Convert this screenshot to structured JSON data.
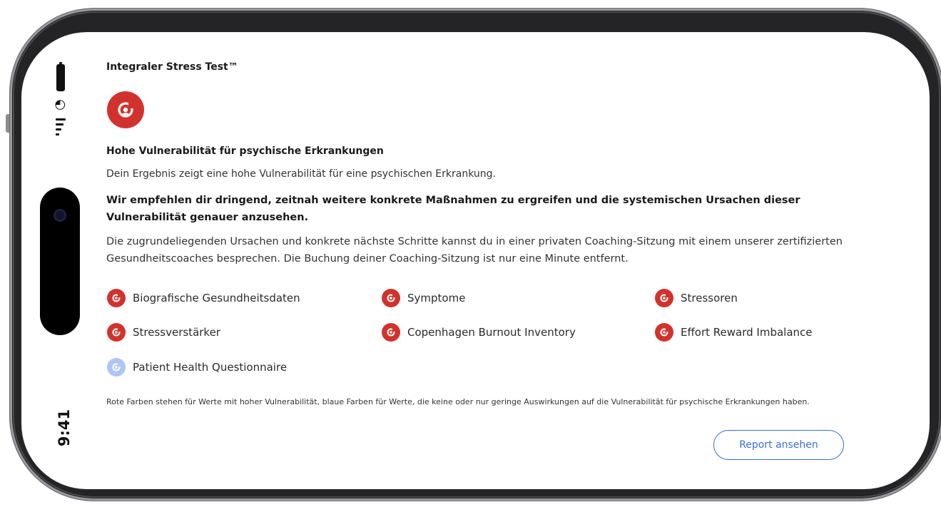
{
  "status_bar": {
    "time": "9:41"
  },
  "app": {
    "title": "Integraler Stress Test™"
  },
  "result": {
    "icon": "stress-gauge-icon",
    "heading": "Hohe Vulnerabilität für psychische Erkrankungen",
    "summary": "Dein Ergebnis zeigt eine hohe Vulnerabilität für eine psychischen Erkrankung.",
    "recommendation": "Wir empfehlen dir dringend, zeitnah weitere konkrete Maßnahmen zu ergreifen und die systemischen Ursachen dieser Vulnerabilität genauer anzusehen.",
    "details": "Die zugrundeliegenden Ursachen und konkrete nächste Schritte kannst du in einer privaten Coaching-Sitzung mit einem unserer zertifizierten Gesundheitscoaches besprechen. Die Buchung deiner Coaching-Sitzung ist nur eine Minute entfernt."
  },
  "factors": [
    {
      "label": "Biografische Gesundheitsdaten",
      "status": "red"
    },
    {
      "label": "Symptome",
      "status": "red"
    },
    {
      "label": "Stressoren",
      "status": "red"
    },
    {
      "label": "Stressverstärker",
      "status": "red"
    },
    {
      "label": "Copenhagen Burnout Inventory",
      "status": "red"
    },
    {
      "label": "Effort Reward Imbalance",
      "status": "red"
    },
    {
      "label": "Patient Health Questionnaire",
      "status": "blue"
    }
  ],
  "legend": "Rote Farben stehen für Werte mit hoher Vulnerabilität, blaue Farben für Werte, die keine oder nur geringe Auswirkungen auf die Vulnerabilität für psychische Erkrankungen haben.",
  "actions": {
    "report_button": "Report ansehen"
  },
  "colors": {
    "red": "#d2322d",
    "blue": "#aec5f5",
    "accent": "#3b6fd6"
  }
}
